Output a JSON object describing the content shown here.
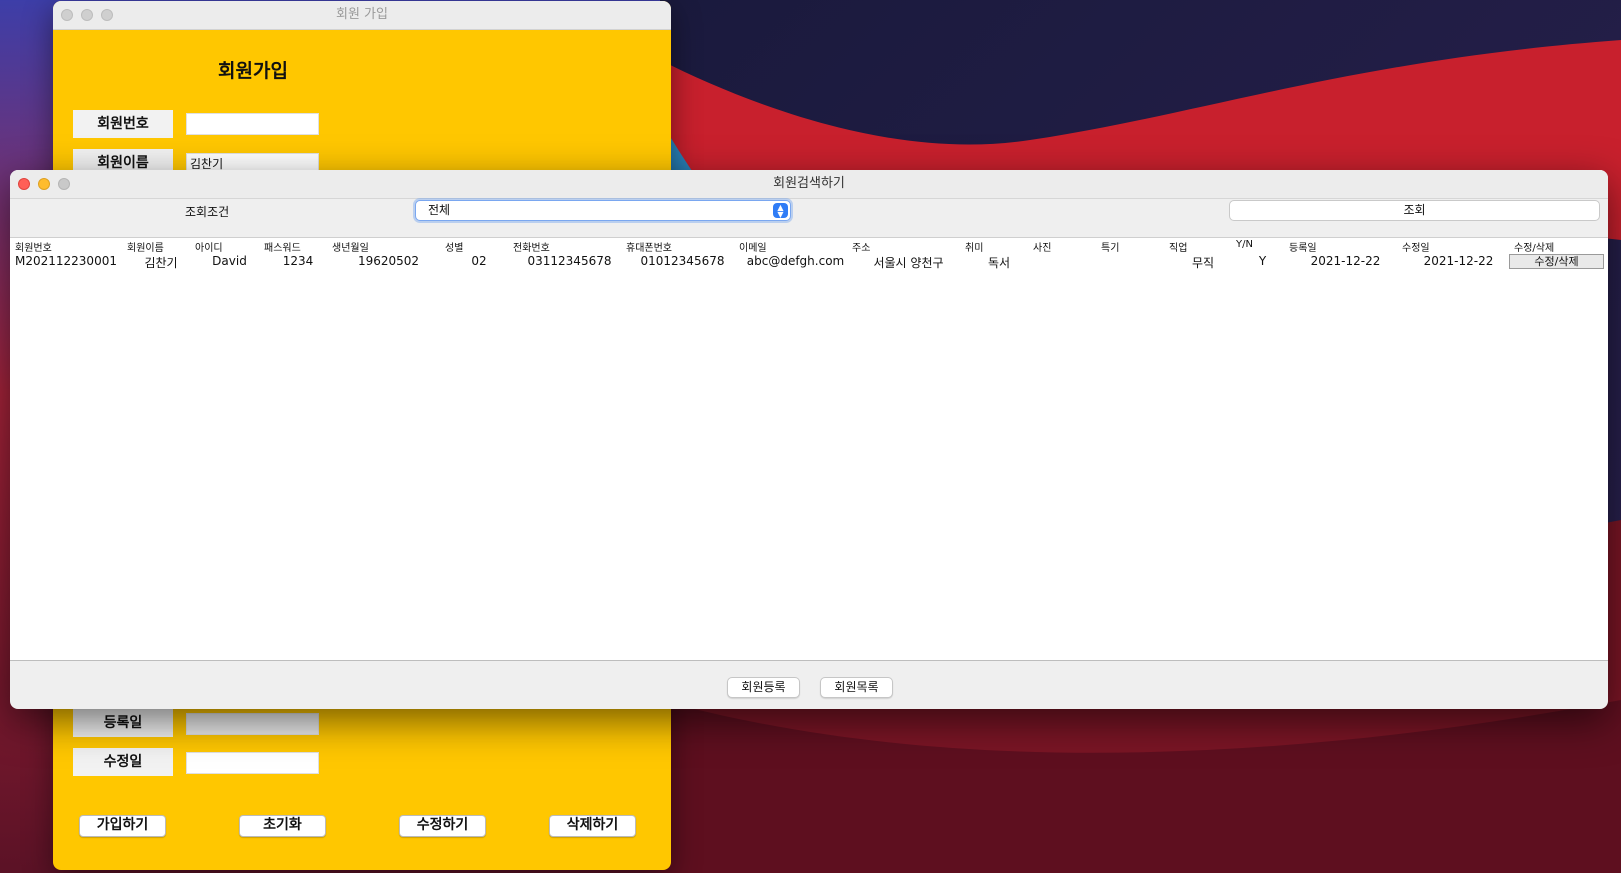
{
  "join_window": {
    "title": "회원 가입",
    "heading": "회원가입",
    "fields": [
      {
        "label": "회원번호",
        "value": ""
      },
      {
        "label": "회원이름",
        "value": "김찬기"
      },
      {
        "label": "등록일",
        "value": ""
      },
      {
        "label": "수정일",
        "value": ""
      }
    ],
    "buttons": [
      "가입하기",
      "초기화",
      "수정하기",
      "삭제하기"
    ]
  },
  "search_window": {
    "title": "회원검색하기",
    "condition_label": "조회조건",
    "condition_value": "전체",
    "query_button": "조회",
    "columns": [
      "회원번호",
      "회원이름",
      "아이디",
      "패스워드",
      "생년월일",
      "성별",
      "전화번호",
      "휴대폰번호",
      "이메일",
      "주소",
      "취미",
      "사진",
      "특기",
      "직업",
      "Y/N",
      "등록일",
      "수정일",
      "수정/삭제"
    ],
    "rows": [
      [
        "M202112230001",
        "김찬기",
        "David",
        "1234",
        "19620502",
        "02",
        "03112345678",
        "01012345678",
        "abc@defgh.com",
        "서울시 양천구",
        "독서",
        "",
        "",
        "무직",
        "Y",
        "2021-12-22",
        "2021-12-22",
        "수정/삭제"
      ]
    ],
    "footer_buttons": [
      "회원등록",
      "회원목록"
    ]
  }
}
